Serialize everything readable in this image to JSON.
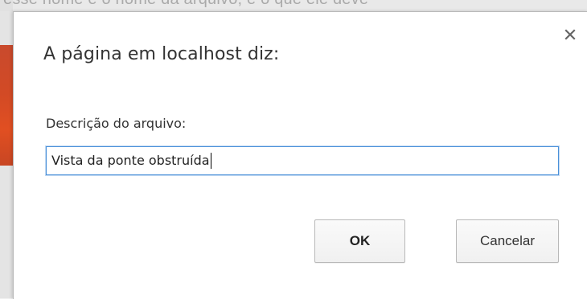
{
  "background": {
    "top_text": "esse nome e o nome da arquivo, e o que ele deve"
  },
  "dialog": {
    "title": "A página em localhost diz:",
    "close_icon": "close-icon",
    "prompt_label": "Descrição do arquivo:",
    "input_value": "Vista da ponte obstruída",
    "ok_label": "OK",
    "cancel_label": "Cancelar"
  },
  "colors": {
    "input_focus_border": "#4a90d9",
    "dialog_background": "#ffffff",
    "background_accent": "#d24a25"
  }
}
